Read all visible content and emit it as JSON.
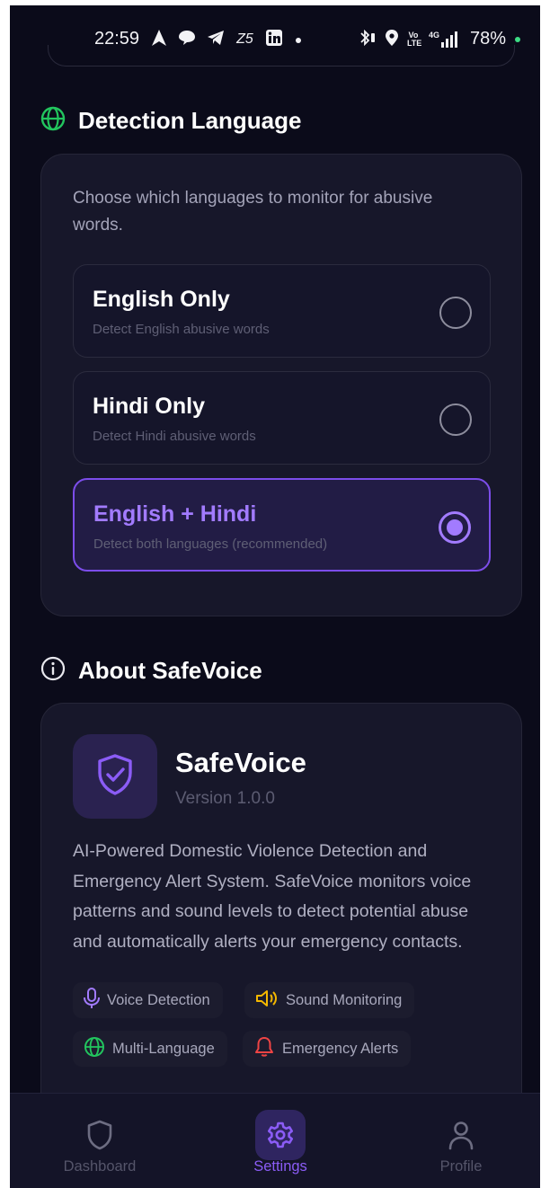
{
  "status_bar": {
    "time": "22:59",
    "battery": "78%",
    "icons_left": [
      "navigation-icon",
      "chat-icon",
      "telegram-icon",
      "z5-icon",
      "linkedin-icon",
      "dot-icon"
    ],
    "icons_right": [
      "bluetooth-icon",
      "location-icon",
      "volte-icon",
      "signal-4g-icon"
    ],
    "z5_text": "Z5",
    "volte_text": "Vo LTE",
    "network_text": "4G"
  },
  "detection_language": {
    "title": "Detection Language",
    "description": "Choose which languages to monitor for abusive words.",
    "options": [
      {
        "title": "English Only",
        "subtitle": "Detect English abusive words",
        "selected": false
      },
      {
        "title": "Hindi Only",
        "subtitle": "Detect Hindi abusive words",
        "selected": false
      },
      {
        "title": "English + Hindi",
        "subtitle": "Detect both languages (recommended)",
        "selected": true
      }
    ]
  },
  "about": {
    "title": "About SafeVoice",
    "app_name": "SafeVoice",
    "version": "Version 1.0.0",
    "description": "AI-Powered Domestic Violence Detection and Emergency Alert System. SafeVoice monitors voice patterns and sound levels to detect potential abuse and automatically alerts your emergency contacts.",
    "features": [
      {
        "label": "Voice Detection",
        "icon": "microphone-icon",
        "color": "#a27bff"
      },
      {
        "label": "Sound Monitoring",
        "icon": "speaker-icon",
        "color": "#f5b800"
      },
      {
        "label": "Multi-Language",
        "icon": "globe-icon",
        "color": "#22c55e"
      },
      {
        "label": "Emergency Alerts",
        "icon": "bell-icon",
        "color": "#ef4444"
      }
    ]
  },
  "bottom_nav": {
    "items": [
      {
        "label": "Dashboard",
        "icon": "shield-icon",
        "active": false
      },
      {
        "label": "Settings",
        "icon": "gear-icon",
        "active": true
      },
      {
        "label": "Profile",
        "icon": "person-icon",
        "active": false
      }
    ]
  },
  "colors": {
    "background": "#0b0b1a",
    "card": "#17172a",
    "accent": "#8b5cf6",
    "globe_green": "#22c55e"
  }
}
